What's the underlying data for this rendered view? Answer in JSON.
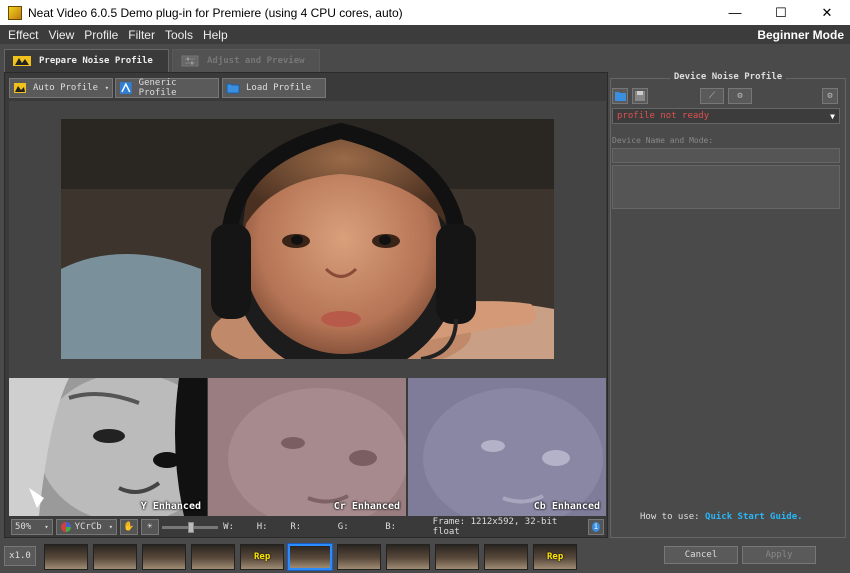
{
  "window": {
    "title": "Neat Video 6.0.5 Demo plug-in for Premiere (using 4 CPU cores, auto)",
    "minimize": "—",
    "maximize": "☐",
    "close": "✕"
  },
  "menu": {
    "items": [
      "Effect",
      "View",
      "Profile",
      "Filter",
      "Tools",
      "Help"
    ],
    "mode": "Beginner Mode"
  },
  "tabs": {
    "prepare": "Prepare Noise Profile",
    "adjust": "Adjust and Preview"
  },
  "toolbar": {
    "auto_profile": "Auto Profile",
    "generic_profile": "Generic Profile",
    "load_profile": "Load Profile"
  },
  "channels": {
    "y": "Y Enhanced",
    "cr": "Cr Enhanced",
    "cb": "Cb Enhanced"
  },
  "status": {
    "zoom": "50%",
    "colorspace": "YCrCb",
    "w": "W:",
    "h": "H:",
    "r": "R:",
    "g": "G:",
    "b": "B:",
    "frame_info": "Frame: 1212x592, 32-bit float"
  },
  "device_profile": {
    "title": "Device Noise Profile",
    "profile_state": "profile not ready",
    "name_label": "Device Name and Mode:",
    "howto_prefix": "How to use:",
    "howto_link": "Quick  Start  Guide",
    "howto_suffix": "."
  },
  "bottom": {
    "speed": "x1.0",
    "rep_label": "Rep",
    "cancel": "Cancel",
    "apply": "Apply"
  },
  "colors": {
    "accent": "#2a8cff",
    "link": "#29b6f6",
    "warning_text": "#e05050",
    "rep_label": "#ffe600"
  }
}
